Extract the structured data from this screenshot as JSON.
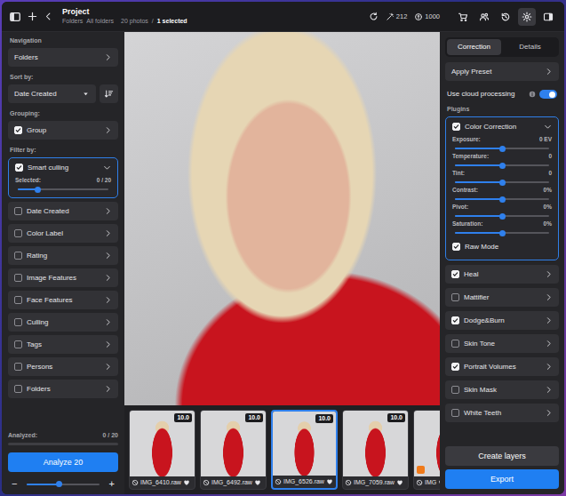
{
  "topbar": {
    "title": "Project",
    "breadcrumb": [
      "Folders",
      "All folders"
    ],
    "count": "20 photos",
    "separator": "/",
    "selected_count": "1 selected",
    "credits": [
      {
        "kind": "wand",
        "value": "212"
      },
      {
        "kind": "coin",
        "value": "1000"
      }
    ],
    "tools": [
      {
        "kind": "cart",
        "selected": false
      },
      {
        "kind": "people",
        "selected": false
      },
      {
        "kind": "history",
        "selected": false
      },
      {
        "kind": "gear",
        "selected": true
      },
      {
        "kind": "panel",
        "selected": false
      }
    ]
  },
  "left": {
    "navigation": {
      "heading": "Navigation",
      "item": "Folders"
    },
    "sort": {
      "heading": "Sort by:",
      "value": "Date Created"
    },
    "grouping": {
      "heading": "Grouping:",
      "item": {
        "label": "Group",
        "checked": true
      }
    },
    "filters": {
      "heading": "Filter by:",
      "items": [
        {
          "label": "Smart culling",
          "checked": true,
          "expanded": true,
          "slider": {
            "label": "Selected:",
            "reading": "0 / 20",
            "level": 0.22
          }
        },
        {
          "label": "Date Created",
          "checked": false,
          "expanded": false
        },
        {
          "label": "Color Label",
          "checked": false,
          "expanded": false
        },
        {
          "label": "Rating",
          "checked": false,
          "expanded": false
        },
        {
          "label": "Image Features",
          "checked": false,
          "expanded": false
        },
        {
          "label": "Face Features",
          "checked": false,
          "expanded": false
        },
        {
          "label": "Culling",
          "checked": false,
          "expanded": false
        },
        {
          "label": "Tags",
          "checked": false,
          "expanded": false
        },
        {
          "label": "Persons",
          "checked": false,
          "expanded": false
        },
        {
          "label": "Folders",
          "checked": false,
          "expanded": false
        }
      ]
    },
    "analysis": {
      "label": "Analyzed:",
      "reading": "0 / 20",
      "level": 0,
      "button": "Analyze 20"
    },
    "zoom": {
      "minus": "−",
      "plus": "+",
      "level": 0.45
    }
  },
  "thumbnails": [
    {
      "name": "IMG_6410.raw",
      "score": "10.0",
      "selected": false,
      "marked": false
    },
    {
      "name": "IMG_6492.raw",
      "score": "10.0",
      "selected": false,
      "marked": false
    },
    {
      "name": "IMG_6526.raw",
      "score": "10.0",
      "selected": true,
      "marked": false
    },
    {
      "name": "IMG_7059.raw",
      "score": "10.0",
      "selected": false,
      "marked": false
    },
    {
      "name": "IMG",
      "selected": false,
      "marked": true
    }
  ],
  "right": {
    "tabs": [
      {
        "label": "Correction",
        "selected": true
      },
      {
        "label": "Details",
        "selected": false
      }
    ],
    "preset": "Apply Preset",
    "cloud": {
      "label": "Use cloud processing",
      "on": true
    },
    "plugins_heading": "Plugins",
    "plugins": [
      {
        "label": "Color Correction",
        "checked": true,
        "expanded": true,
        "sliders": [
          {
            "label": "Exposure:",
            "reading": "0 EV",
            "level": 0.5
          },
          {
            "label": "Temperature:",
            "reading": "0",
            "level": 0.5
          },
          {
            "label": "Tint:",
            "reading": "0",
            "level": 0.5
          },
          {
            "label": "Contrast:",
            "reading": "0%",
            "level": 0.5
          },
          {
            "label": "Pivot:",
            "reading": "0%",
            "level": 0.5
          },
          {
            "label": "Saturation:",
            "reading": "0%",
            "level": 0.5
          }
        ],
        "options": [
          {
            "label": "Raw Mode",
            "checked": true
          }
        ]
      },
      {
        "label": "Heal",
        "checked": true,
        "expanded": false
      },
      {
        "label": "Mattifier",
        "checked": false,
        "expanded": false
      },
      {
        "label": "Dodge&Burn",
        "checked": true,
        "expanded": false
      },
      {
        "label": "Skin Tone",
        "checked": false,
        "expanded": false
      },
      {
        "label": "Portrait Volumes",
        "checked": true,
        "expanded": false
      },
      {
        "label": "Skin Mask",
        "checked": false,
        "expanded": false
      },
      {
        "label": "White Teeth",
        "checked": false,
        "expanded": false
      }
    ],
    "buttons": [
      {
        "label": "Create layers",
        "kind": "secondary"
      },
      {
        "label": "Export",
        "kind": "primary"
      }
    ]
  }
}
